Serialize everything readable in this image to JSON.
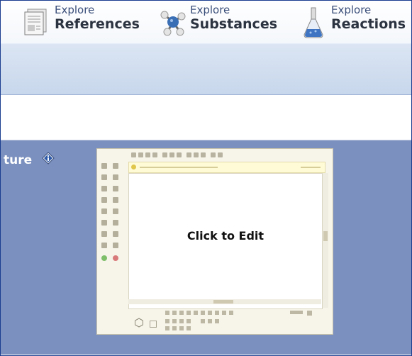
{
  "nav": {
    "items": [
      {
        "small": "Explore",
        "big": "References",
        "icon": "references-document-icon"
      },
      {
        "small": "Explore",
        "big": "Substances",
        "icon": "substances-molecule-icon"
      },
      {
        "small": "Explore",
        "big": "Reactions",
        "icon": "reactions-flask-icon"
      }
    ]
  },
  "panel": {
    "title": "ture",
    "info_icon": "info-diamond-icon"
  },
  "editor": {
    "canvas_label": "Click to Edit"
  },
  "colors": {
    "panel_bg": "#7b90bf",
    "frame_border": "#1b3d8f",
    "nav_text": "#2c3340",
    "nav_small_text": "#3a4f7a"
  }
}
